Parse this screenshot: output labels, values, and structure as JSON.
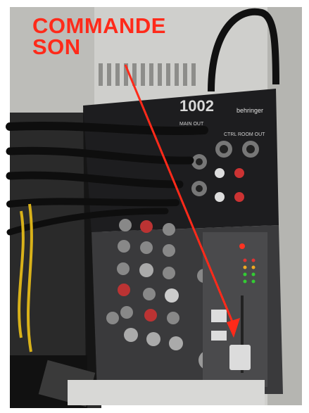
{
  "annotation": {
    "line1": "COMMANDE",
    "line2": "SON",
    "color": "#ff2a1a"
  },
  "device": {
    "brand": "behringer",
    "model_fragment": "1002",
    "panel_text_main_out": "MAIN OUT",
    "panel_text_ctrl_room": "CTRL ROOM OUT"
  }
}
